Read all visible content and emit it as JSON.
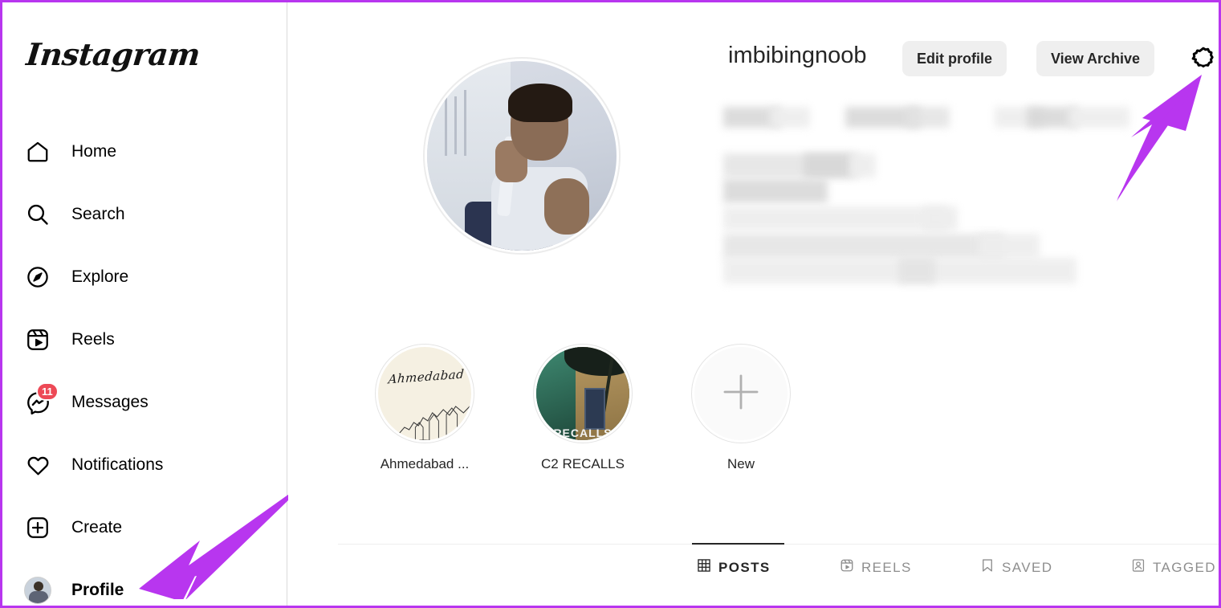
{
  "brand": {
    "name": "Instagram",
    "logo_icon": "instagram-wordmark"
  },
  "sidebar": {
    "items": [
      {
        "label": "Home",
        "icon": "home-icon",
        "active": false,
        "badge": null
      },
      {
        "label": "Search",
        "icon": "search-icon",
        "active": false,
        "badge": null
      },
      {
        "label": "Explore",
        "icon": "compass-icon",
        "active": false,
        "badge": null
      },
      {
        "label": "Reels",
        "icon": "reels-icon",
        "active": false,
        "badge": null
      },
      {
        "label": "Messages",
        "icon": "messenger-icon",
        "active": false,
        "badge": "11"
      },
      {
        "label": "Notifications",
        "icon": "heart-icon",
        "active": false,
        "badge": null
      },
      {
        "label": "Create",
        "icon": "plus-square-icon",
        "active": false,
        "badge": null
      },
      {
        "label": "Profile",
        "icon": "profile-avatar",
        "active": true,
        "badge": null
      }
    ]
  },
  "profile": {
    "username": "imbibingnoob",
    "avatar_icon": "profile-picture",
    "edit_profile_label": "Edit profile",
    "view_archive_label": "View Archive",
    "settings_icon": "gear-icon",
    "stats_redacted": true,
    "stats_visible_fragment": "ing",
    "bio_redacted": true
  },
  "highlights": [
    {
      "label": "Ahmedabad ...",
      "thumb": "ahmedabad-skyline-thumb",
      "thumb_text": "Ahmedabad",
      "is_new": false
    },
    {
      "label": "C2 RECALLS",
      "thumb": "c2-recalls-photo-thumb",
      "thumb_text": "RECALLS",
      "is_new": false
    },
    {
      "label": "New",
      "thumb": "new-highlight-plus",
      "thumb_text": "",
      "is_new": true
    }
  ],
  "tabs": [
    {
      "label": "POSTS",
      "icon": "grid-icon",
      "active": true
    },
    {
      "label": "REELS",
      "icon": "reels-icon",
      "active": false
    },
    {
      "label": "SAVED",
      "icon": "bookmark-icon",
      "active": false
    },
    {
      "label": "TAGGED",
      "icon": "tagged-icon",
      "active": false
    }
  ],
  "annotations": {
    "arrow_color": "#b836ef",
    "arrow_to_settings": "arrow-pointing-to-settings-gear",
    "arrow_to_profile": "arrow-pointing-to-profile-nav"
  },
  "colors": {
    "accent_purple": "#b836ef",
    "badge_red": "#ed4956",
    "text_primary": "#262626",
    "text_muted": "#8e8e8e",
    "button_bg": "#efefef",
    "border": "#dbdbdb"
  }
}
